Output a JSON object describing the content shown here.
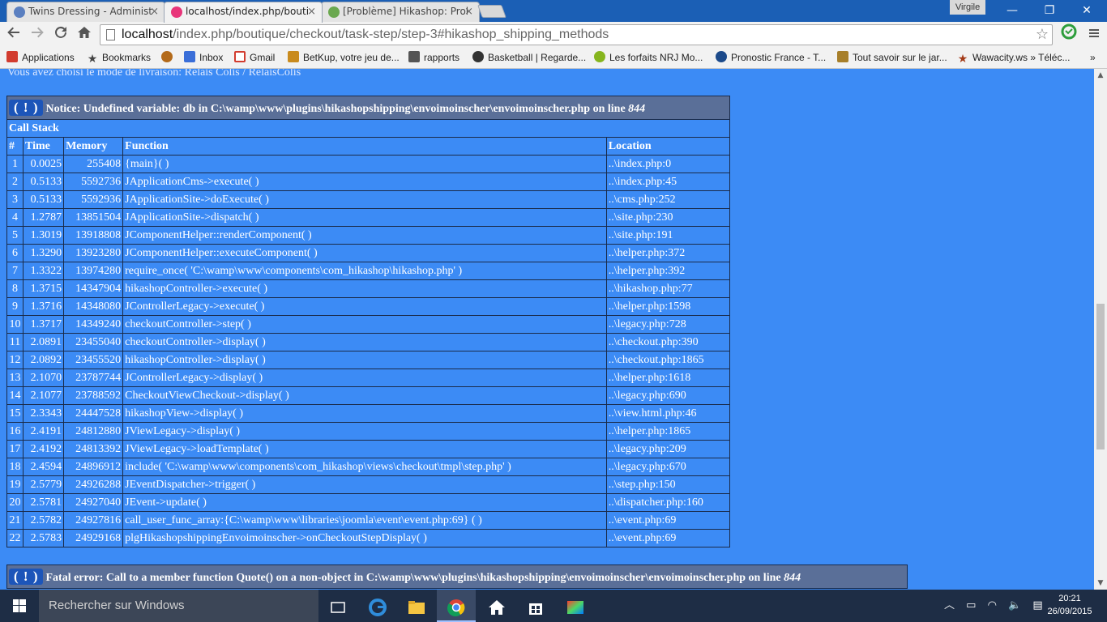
{
  "browser": {
    "tabs": [
      {
        "label": "Twins Dressing - Administ",
        "close": "×"
      },
      {
        "label": "localhost/index.php/bouti",
        "close": "×"
      },
      {
        "label": "[Problème] Hikashop: Prol",
        "close": "×"
      }
    ],
    "user": "Virgile",
    "window_controls": {
      "minimize": "—",
      "restore": "❐",
      "close": "✕"
    },
    "url_host": "localhost",
    "url_path": "/index.php/boutique/checkout/task-step/step-3#hikashop_shipping_methods",
    "bookmarks": [
      {
        "label": "Applications",
        "icon": "apps-icon",
        "color": "#d23c2f"
      },
      {
        "label": "Bookmarks",
        "icon": "star-icon",
        "color": "#444444"
      },
      {
        "label": "",
        "icon": "globe-icon",
        "color": "#b36a1a"
      },
      {
        "label": "Inbox",
        "icon": "inbox-icon",
        "color": "#3a6ed8"
      },
      {
        "label": "Gmail",
        "icon": "gmail-icon",
        "color": "#d23c2f"
      },
      {
        "label": "BetKup, votre jeu de...",
        "icon": "betkup-icon",
        "color": "#c98b1e"
      },
      {
        "label": "rapports",
        "icon": "report-icon",
        "color": "#555555"
      },
      {
        "label": "Basketball | Regarde...",
        "icon": "basketball-icon",
        "color": "#333333"
      },
      {
        "label": "Les forfaits NRJ Mo...",
        "icon": "nrj-icon",
        "color": "#86b51e"
      },
      {
        "label": "Pronostic France - T...",
        "icon": "pronostic-icon",
        "color": "#1c4a8a"
      },
      {
        "label": "Tout savoir sur le jar...",
        "icon": "garden-icon",
        "color": "#a77f2a"
      },
      {
        "label": "Wawacity.ws » Téléc...",
        "icon": "wawacity-icon",
        "color": "#a33a17"
      }
    ],
    "bookmarks_more": "»"
  },
  "page": {
    "message": "Vous avez choisi le mode de livraison: Relais Colis / RelaisColis",
    "notice": {
      "bang": "( ! )",
      "text": "Notice: Undefined variable: db in C:\\wamp\\www\\plugins\\hikashopshipping\\envoimoinscher\\envoimoinscher.php on line ",
      "line": "844",
      "call_stack_label": "Call Stack",
      "columns": [
        "#",
        "Time",
        "Memory",
        "Function",
        "Location"
      ],
      "rows": [
        [
          "1",
          "0.0025",
          "255408",
          "{main}( )",
          "..\\index.php:0"
        ],
        [
          "2",
          "0.5133",
          "5592736",
          "JApplicationCms->execute( )",
          "..\\index.php:45"
        ],
        [
          "3",
          "0.5133",
          "5592936",
          "JApplicationSite->doExecute( )",
          "..\\cms.php:252"
        ],
        [
          "4",
          "1.2787",
          "13851504",
          "JApplicationSite->dispatch( )",
          "..\\site.php:230"
        ],
        [
          "5",
          "1.3019",
          "13918808",
          "JComponentHelper::renderComponent( )",
          "..\\site.php:191"
        ],
        [
          "6",
          "1.3290",
          "13923280",
          "JComponentHelper::executeComponent( )",
          "..\\helper.php:372"
        ],
        [
          "7",
          "1.3322",
          "13974280",
          "require_once( 'C:\\wamp\\www\\components\\com_hikashop\\hikashop.php' )",
          "..\\helper.php:392"
        ],
        [
          "8",
          "1.3715",
          "14347904",
          "hikashopController->execute( )",
          "..\\hikashop.php:77"
        ],
        [
          "9",
          "1.3716",
          "14348080",
          "JControllerLegacy->execute( )",
          "..\\helper.php:1598"
        ],
        [
          "10",
          "1.3717",
          "14349240",
          "checkoutController->step( )",
          "..\\legacy.php:728"
        ],
        [
          "11",
          "2.0891",
          "23455040",
          "checkoutController->display( )",
          "..\\checkout.php:390"
        ],
        [
          "12",
          "2.0892",
          "23455520",
          "hikashopController->display( )",
          "..\\checkout.php:1865"
        ],
        [
          "13",
          "2.1070",
          "23787744",
          "JControllerLegacy->display( )",
          "..\\helper.php:1618"
        ],
        [
          "14",
          "2.1077",
          "23788592",
          "CheckoutViewCheckout->display( )",
          "..\\legacy.php:690"
        ],
        [
          "15",
          "2.3343",
          "24447528",
          "hikashopView->display( )",
          "..\\view.html.php:46"
        ],
        [
          "16",
          "2.4191",
          "24812880",
          "JViewLegacy->display( )",
          "..\\helper.php:1865"
        ],
        [
          "17",
          "2.4192",
          "24813392",
          "JViewLegacy->loadTemplate( )",
          "..\\legacy.php:209"
        ],
        [
          "18",
          "2.4594",
          "24896912",
          "include( 'C:\\wamp\\www\\components\\com_hikashop\\views\\checkout\\tmpl\\step.php' )",
          "..\\legacy.php:670"
        ],
        [
          "19",
          "2.5779",
          "24926288",
          "JEventDispatcher->trigger( )",
          "..\\step.php:150"
        ],
        [
          "20",
          "2.5781",
          "24927040",
          "JEvent->update( )",
          "..\\dispatcher.php:160"
        ],
        [
          "21",
          "2.5782",
          "24927816",
          "call_user_func_array:{C:\\wamp\\www\\libraries\\joomla\\event\\event.php:69} ( )",
          "..\\event.php:69"
        ],
        [
          "22",
          "2.5783",
          "24929168",
          "plgHikashopshippingEnvoimoinscher->onCheckoutStepDisplay( )",
          "..\\event.php:69"
        ]
      ]
    },
    "fatal": {
      "bang": "( ! )",
      "text": "Fatal error: Call to a member function Quote() on a non-object in C:\\wamp\\www\\plugins\\hikashopshipping\\envoimoinscher\\envoimoinscher.php on line ",
      "line": "844"
    }
  },
  "taskbar": {
    "search_placeholder": "Rechercher sur Windows",
    "time": "20:21",
    "date": "26/09/2015"
  },
  "colors": {
    "page_bg": "#3c8bf5",
    "notice_header": "#5a6f98",
    "taskbar": "#1e2d45"
  }
}
